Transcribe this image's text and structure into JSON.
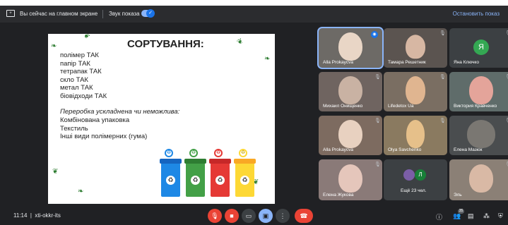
{
  "topbar": {
    "present_status": "Вы сейчас на главном экране",
    "sound_label": "Звук показа",
    "stop_label": "Остановить показ"
  },
  "slide": {
    "title": "СОРТУВАННЯ:",
    "items": [
      "полімер ТАК",
      "папір ТАК",
      "тетрапак ТАК",
      "скло ТАК",
      "метал ТАК",
      "біовідходи ТАК"
    ],
    "subheading": "Переробка ускладнена чи неможлива:",
    "hard_items": [
      "Комбінована упаковка",
      "Текстиль",
      "Інші види полімерних (гума)"
    ]
  },
  "participants": [
    {
      "name": "Alla Prokaycva",
      "mic": "active"
    },
    {
      "name": "Тамара Решетник",
      "mic": "muted"
    },
    {
      "name": "Яна Ключко",
      "mic": "muted",
      "avatar_letter": "Я"
    },
    {
      "name": "Михаил Онищенко",
      "mic": "muted"
    },
    {
      "name": "Lifedetox Ua",
      "mic": "muted"
    },
    {
      "name": "Виктория Кравченко",
      "mic": "muted"
    },
    {
      "name": "Alla Prokaycva",
      "mic": "muted"
    },
    {
      "name": "Olya Savchenko",
      "mic": "muted"
    },
    {
      "name": "Елена Мазюк",
      "mic": "muted"
    },
    {
      "name": "Елена Жукова",
      "mic": "muted"
    },
    {
      "name": "Ещё 23 чел.",
      "mic": "none",
      "avatar_letter": "Л"
    },
    {
      "name": "Эль",
      "mic": "muted"
    }
  ],
  "bottombar": {
    "time": "11:14",
    "meeting_code": "xti-okkr-its",
    "participants_badge": "35"
  },
  "colors": {
    "accent": "#8ab4f8",
    "end_call": "#ea4335",
    "bin_blue": "#1e88e5",
    "bin_green": "#43a047",
    "bin_red": "#e53935",
    "bin_yellow": "#fdd835"
  },
  "icons": [
    "present-icon",
    "speaker-toggle",
    "mic-off-icon",
    "camera-off-icon",
    "captions-icon",
    "present-now-icon",
    "more-icon",
    "hang-up-icon",
    "info-icon",
    "people-icon",
    "chat-icon",
    "activities-icon",
    "security-icon"
  ]
}
